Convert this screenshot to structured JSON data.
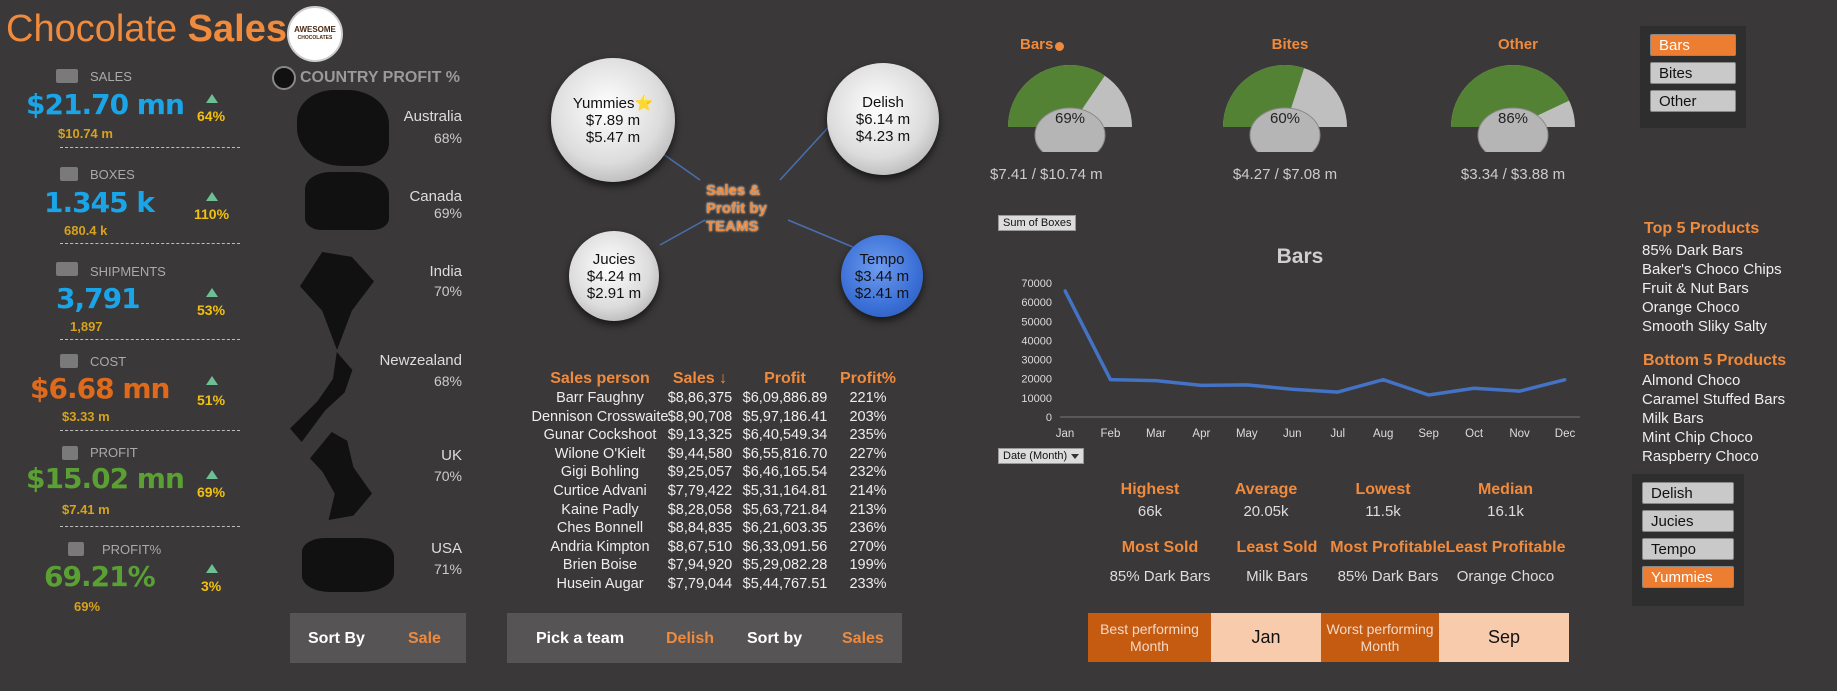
{
  "header": {
    "title_part1": "Chocolate ",
    "title_part2": "Sales",
    "logo_line1": "AWESOME",
    "logo_line2": "CHOCOLATES"
  },
  "kpis": [
    {
      "label": "SALES",
      "value": "$21.70 mn",
      "sub": "$10.74 m",
      "pct": "64%",
      "color": "#1aa5e8"
    },
    {
      "label": "BOXES",
      "value": "1.345 k",
      "sub": "680.4 k",
      "pct": "110%",
      "color": "#1aa5e8"
    },
    {
      "label": "SHIPMENTS",
      "value": "3,791",
      "sub": "1,897",
      "pct": "53%",
      "color": "#1aa5e8"
    },
    {
      "label": "COST",
      "value": "$6.68 mn",
      "sub": "$3.33 m",
      "pct": "51%",
      "color": "#e06a1c"
    },
    {
      "label": "PROFIT",
      "value": "$15.02 mn",
      "sub": "$7.41 m",
      "pct": "69%",
      "color": "#5aa033"
    },
    {
      "label": "PROFIT%",
      "value": "69.21%",
      "sub": "69%",
      "pct": "3%",
      "color": "#5aa033"
    }
  ],
  "country": {
    "title": "COUNTRY PROFIT %",
    "items": [
      {
        "name": "Australia",
        "pct": "68%"
      },
      {
        "name": "Canada",
        "pct": "69%"
      },
      {
        "name": "India",
        "pct": "70%"
      },
      {
        "name": "Newzealand",
        "pct": "68%"
      },
      {
        "name": "UK",
        "pct": "70%"
      },
      {
        "name": "USA",
        "pct": "71%"
      }
    ],
    "sort_label": "Sort By",
    "sort_value": "Sale"
  },
  "teams": {
    "center_label": "Sales & Profit by TEAMS",
    "bubbles": [
      {
        "name": "Yummies",
        "star": "⭐",
        "sales": "$7.89 m",
        "profit": "$5.47 m"
      },
      {
        "name": "Delish",
        "star": "",
        "sales": "$6.14 m",
        "profit": "$4.23 m"
      },
      {
        "name": "Jucies",
        "star": "",
        "sales": "$4.24 m",
        "profit": "$2.91 m"
      },
      {
        "name": "Tempo",
        "star": "",
        "sales": "$3.44 m",
        "profit": "$2.41 m"
      }
    ]
  },
  "sales_table": {
    "headers": [
      "Sales person",
      "Sales ↓",
      "Profit",
      "Profit%"
    ],
    "rows": [
      [
        "Barr Faughny",
        "$8,86,375",
        "$6,09,886.89",
        "221%"
      ],
      [
        "Dennison Crosswaite",
        "$8,90,708",
        "$5,97,186.41",
        "203%"
      ],
      [
        "Gunar Cockshoot",
        "$9,13,325",
        "$6,40,549.34",
        "235%"
      ],
      [
        "Wilone O'Kielt",
        "$9,44,580",
        "$6,55,816.70",
        "227%"
      ],
      [
        "Gigi Bohling",
        "$9,25,057",
        "$6,46,165.54",
        "232%"
      ],
      [
        "Curtice Advani",
        "$7,79,422",
        "$5,31,164.81",
        "214%"
      ],
      [
        "Kaine Padly",
        "$8,28,058",
        "$5,63,721.84",
        "213%"
      ],
      [
        "Ches Bonnell",
        "$8,84,835",
        "$6,21,603.35",
        "236%"
      ],
      [
        "Andria Kimpton",
        "$8,67,510",
        "$6,33,091.56",
        "270%"
      ],
      [
        "Brien Boise",
        "$7,94,920",
        "$5,29,082.28",
        "199%"
      ],
      [
        "Husein Augar",
        "$7,79,044",
        "$5,44,767.51",
        "233%"
      ]
    ],
    "pick_label": "Pick a team",
    "pick_value": "Delish",
    "sort_label": "Sort by",
    "sort_value": "Sales"
  },
  "gauges": [
    {
      "title": "Bars",
      "pct_label": "69%",
      "pct": 0.69,
      "sub": "$7.41 / $10.74 m"
    },
    {
      "title": "Bites",
      "pct_label": "60%",
      "pct": 0.6,
      "sub": "$4.27 / $7.08 m"
    },
    {
      "title": "Other",
      "pct_label": "86%",
      "pct": 0.86,
      "sub": "$3.34 / $3.88 m"
    }
  ],
  "category_slicer": {
    "items": [
      "Bars",
      "Bites",
      "Other"
    ],
    "selected": "Bars"
  },
  "chart_data": {
    "type": "line",
    "title": "Bars",
    "field_button": "Sum of Boxes",
    "axis_button": "Date (Month)",
    "categories": [
      "Jan",
      "Feb",
      "Mar",
      "Apr",
      "May",
      "Jun",
      "Jul",
      "Aug",
      "Sep",
      "Oct",
      "Nov",
      "Dec"
    ],
    "values": [
      66000,
      19500,
      19000,
      16500,
      16800,
      14500,
      13000,
      19500,
      11500,
      15000,
      13500,
      19500
    ],
    "yticks": [
      "70000",
      "60000",
      "50000",
      "40000",
      "30000",
      "20000",
      "10000",
      "0"
    ],
    "ylim": [
      0,
      70000
    ],
    "color": "#4472c4",
    "grid": false
  },
  "stats": {
    "row1": [
      {
        "h": "Highest",
        "v": "66k"
      },
      {
        "h": "Average",
        "v": "20.05k"
      },
      {
        "h": "Lowest",
        "v": "11.5k"
      },
      {
        "h": "Median",
        "v": "16.1k"
      }
    ],
    "row2": [
      {
        "h": "Most Sold",
        "v": "85% Dark Bars"
      },
      {
        "h": "Least Sold",
        "v": "Milk Bars"
      },
      {
        "h": "Most Profitable",
        "v": "85% Dark Bars"
      },
      {
        "h": "Least Profitable",
        "v": "Orange Choco"
      }
    ],
    "best_label": "Best performing Month",
    "best_value": "Jan",
    "worst_label": "Worst performing Month",
    "worst_value": "Sep"
  },
  "products": {
    "top_title": "Top 5 Products",
    "top": [
      "85% Dark Bars",
      "Baker's Choco Chips",
      "Fruit & Nut Bars",
      "Orange Choco",
      "Smooth Sliky Salty"
    ],
    "bottom_title": "Bottom 5 Products",
    "bottom": [
      "Almond Choco",
      "Caramel Stuffed Bars",
      "Milk Bars",
      "Mint Chip Choco",
      "Raspberry Choco"
    ]
  },
  "team_slicer": {
    "items": [
      "Delish",
      "Jucies",
      "Tempo",
      "Yummies"
    ],
    "selected": "Yummies"
  }
}
